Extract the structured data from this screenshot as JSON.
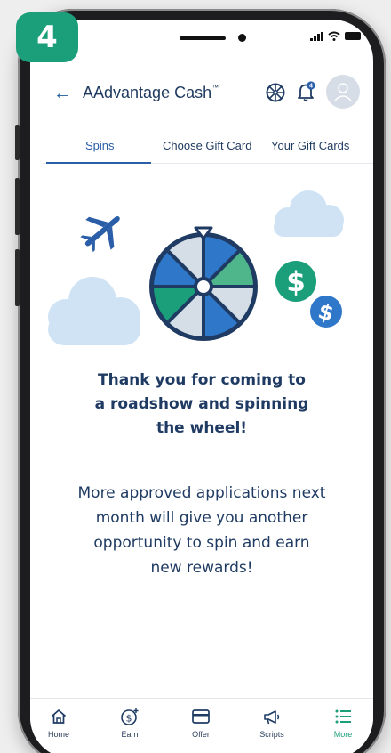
{
  "step_badge": "4",
  "header": {
    "title": "AAdvantage Cash",
    "trademark": "™",
    "notification_count": "4"
  },
  "tabs": [
    {
      "label": "Spins",
      "active": true
    },
    {
      "label": "Choose Gift Card",
      "active": false
    },
    {
      "label": "Your Gift Cards",
      "active": false
    }
  ],
  "message": {
    "title_lines": [
      "Thank you for coming to",
      "a roadshow and spinning",
      "the wheel!"
    ],
    "body_lines": [
      "More approved applications next",
      "month will give you another",
      "opportunity to spin and earn",
      "new rewards!"
    ]
  },
  "bottom_nav": [
    {
      "label": "Home",
      "icon": "home-icon",
      "active": false
    },
    {
      "label": "Earn",
      "icon": "dollar-plus-icon",
      "active": false
    },
    {
      "label": "Offer",
      "icon": "card-icon",
      "active": false
    },
    {
      "label": "Scripts",
      "icon": "megaphone-icon",
      "active": false
    },
    {
      "label": "More",
      "icon": "list-icon",
      "active": true
    }
  ],
  "colors": {
    "navy": "#1f3b63",
    "blue": "#2b5ea8",
    "green": "#1b9e7a",
    "cloud": "#cfe3f5"
  }
}
